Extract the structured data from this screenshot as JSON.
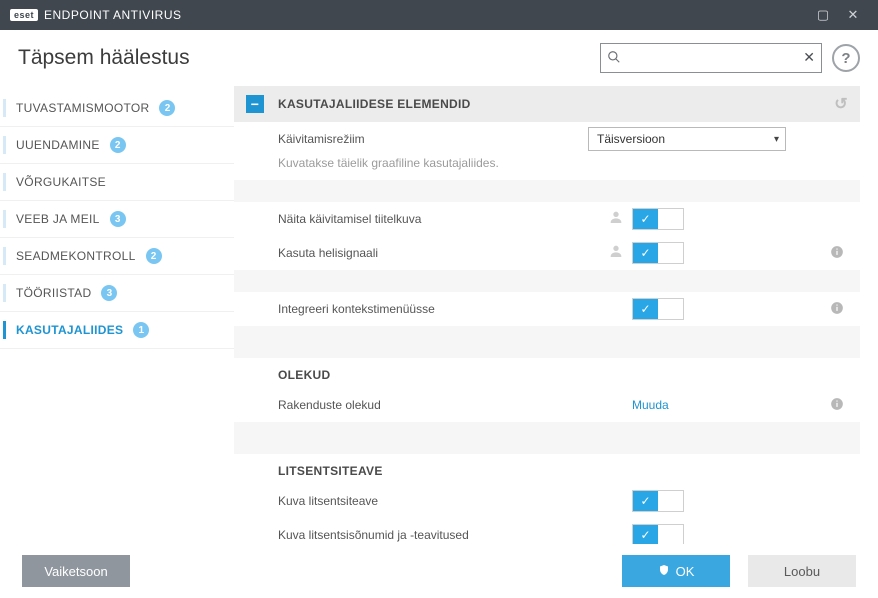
{
  "titlebar": {
    "brand_badge": "eset",
    "title": "ENDPOINT ANTIVIRUS"
  },
  "header": {
    "title": "Täpsem häälestus",
    "search_value": "",
    "search_placeholder": ""
  },
  "sidebar": {
    "items": [
      {
        "label": "TUVASTAMISMOOTOR",
        "badge": "2",
        "active": false
      },
      {
        "label": "UUENDAMINE",
        "badge": "2",
        "active": false
      },
      {
        "label": "VÕRGUKAITSE",
        "badge": "",
        "active": false
      },
      {
        "label": "VEEB JA MEIL",
        "badge": "3",
        "active": false
      },
      {
        "label": "SEADMEKONTROLL",
        "badge": "2",
        "active": false
      },
      {
        "label": "TÖÖRIISTAD",
        "badge": "3",
        "active": false
      },
      {
        "label": "KASUTAJALIIDES",
        "badge": "1",
        "active": true
      }
    ]
  },
  "section": {
    "title": "KASUTAJALIIDESE ELEMENDID",
    "mode_label": "Käivitamisrežiim",
    "mode_value": "Täisversioon",
    "mode_desc": "Kuvatakse täielik graafiline kasutajaliides.",
    "show_splash_label": "Näita käivitamisel tiitelkuva",
    "use_sound_label": "Kasuta helisignaali",
    "integrate_context_label": "Integreeri kontekstimenüüsse",
    "statuses_header": "OLEKUD",
    "app_statuses_label": "Rakenduste olekud",
    "app_statuses_link": "Muuda",
    "license_header": "LITSENTSITEAVE",
    "show_license_label": "Kuva litsentsiteave",
    "show_license_msgs_label": "Kuva litsentsisõnumid ja -teavitused"
  },
  "footer": {
    "default_label": "Vaiketsoon",
    "ok_label": "OK",
    "cancel_label": "Loobu"
  }
}
